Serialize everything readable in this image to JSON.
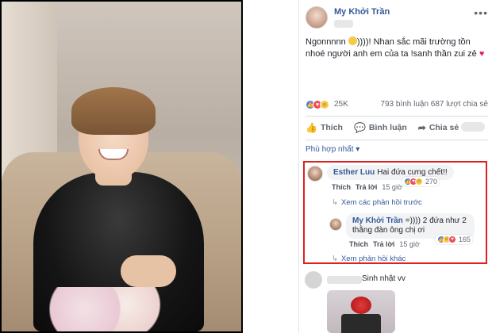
{
  "post": {
    "author": "My Khởi Trần",
    "more_icon": "•••",
    "text_part1": "Ngonnnnn ",
    "text_part2": "))))! Nhan sắc mãi trường tồn nhoé người anh em của ta !sanh thần zui zẻ ",
    "text_heart": "♥",
    "reaction_count": "25K",
    "comments_shares": "793 bình luận  687 lượt chia sẻ"
  },
  "actions": {
    "like": "Thích",
    "comment": "Bình luận",
    "share": "Chia sẻ"
  },
  "sort": {
    "label": "Phù hợp nhất ▾"
  },
  "comments": [
    {
      "name": "Esther Luu",
      "text": "Hai đứa cưng chết!!",
      "like": "Thích",
      "reply": "Trả lời",
      "time": "15 giờ",
      "reactions": "270"
    },
    {
      "name": "My Khởi Trần",
      "text_line1": "=)))) 2 đứa như 2",
      "text_line2": "thằng đàn ông chị ơi",
      "like": "Thích",
      "reply": "Trả lời",
      "time": "15 giờ",
      "reactions": "165"
    }
  ],
  "view_previous": "Xem các phản hồi trước",
  "view_more": "Xem phản hồi khác",
  "last_comment_text": "Sinh nhật vv",
  "colors": {
    "link": "#365899",
    "highlight": "#e02020"
  }
}
